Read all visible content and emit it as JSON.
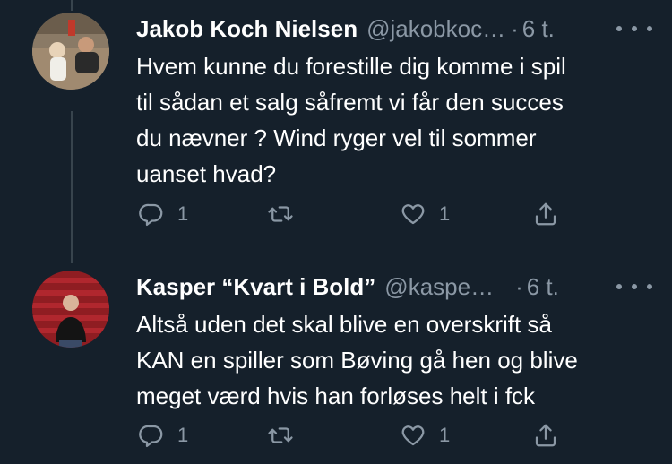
{
  "tweets": [
    {
      "author_name": "Jakob Koch Nielsen",
      "handle": "@jakobkoc…",
      "separator": "·",
      "time": "6 t.",
      "lines": [
        "Hvem kunne du forestille dig komme i spil",
        "til sådan et salg såfremt vi får den succes",
        "du nævner ? Wind ryger vel til sommer",
        "uanset hvad?"
      ],
      "reply_count": "1",
      "retweet_count": "",
      "like_count": "1"
    },
    {
      "author_name": "Kasper “Kvart i Bold”",
      "handle": "@kaspe…",
      "separator": "·",
      "time": "6 t.",
      "lines": [
        "Altså uden det skal blive en overskrift så",
        "KAN en spiller som Bøving gå hen og blive",
        "meget værd hvis han forløses helt i fck"
      ],
      "reply_count": "1",
      "retweet_count": "",
      "like_count": "1"
    }
  ],
  "colors": {
    "background": "#15202b",
    "text": "#ffffff",
    "muted": "#8b98a5",
    "thread_line": "#38444d"
  },
  "icons": [
    "reply-icon",
    "retweet-icon",
    "like-icon",
    "share-icon",
    "more-icon"
  ]
}
